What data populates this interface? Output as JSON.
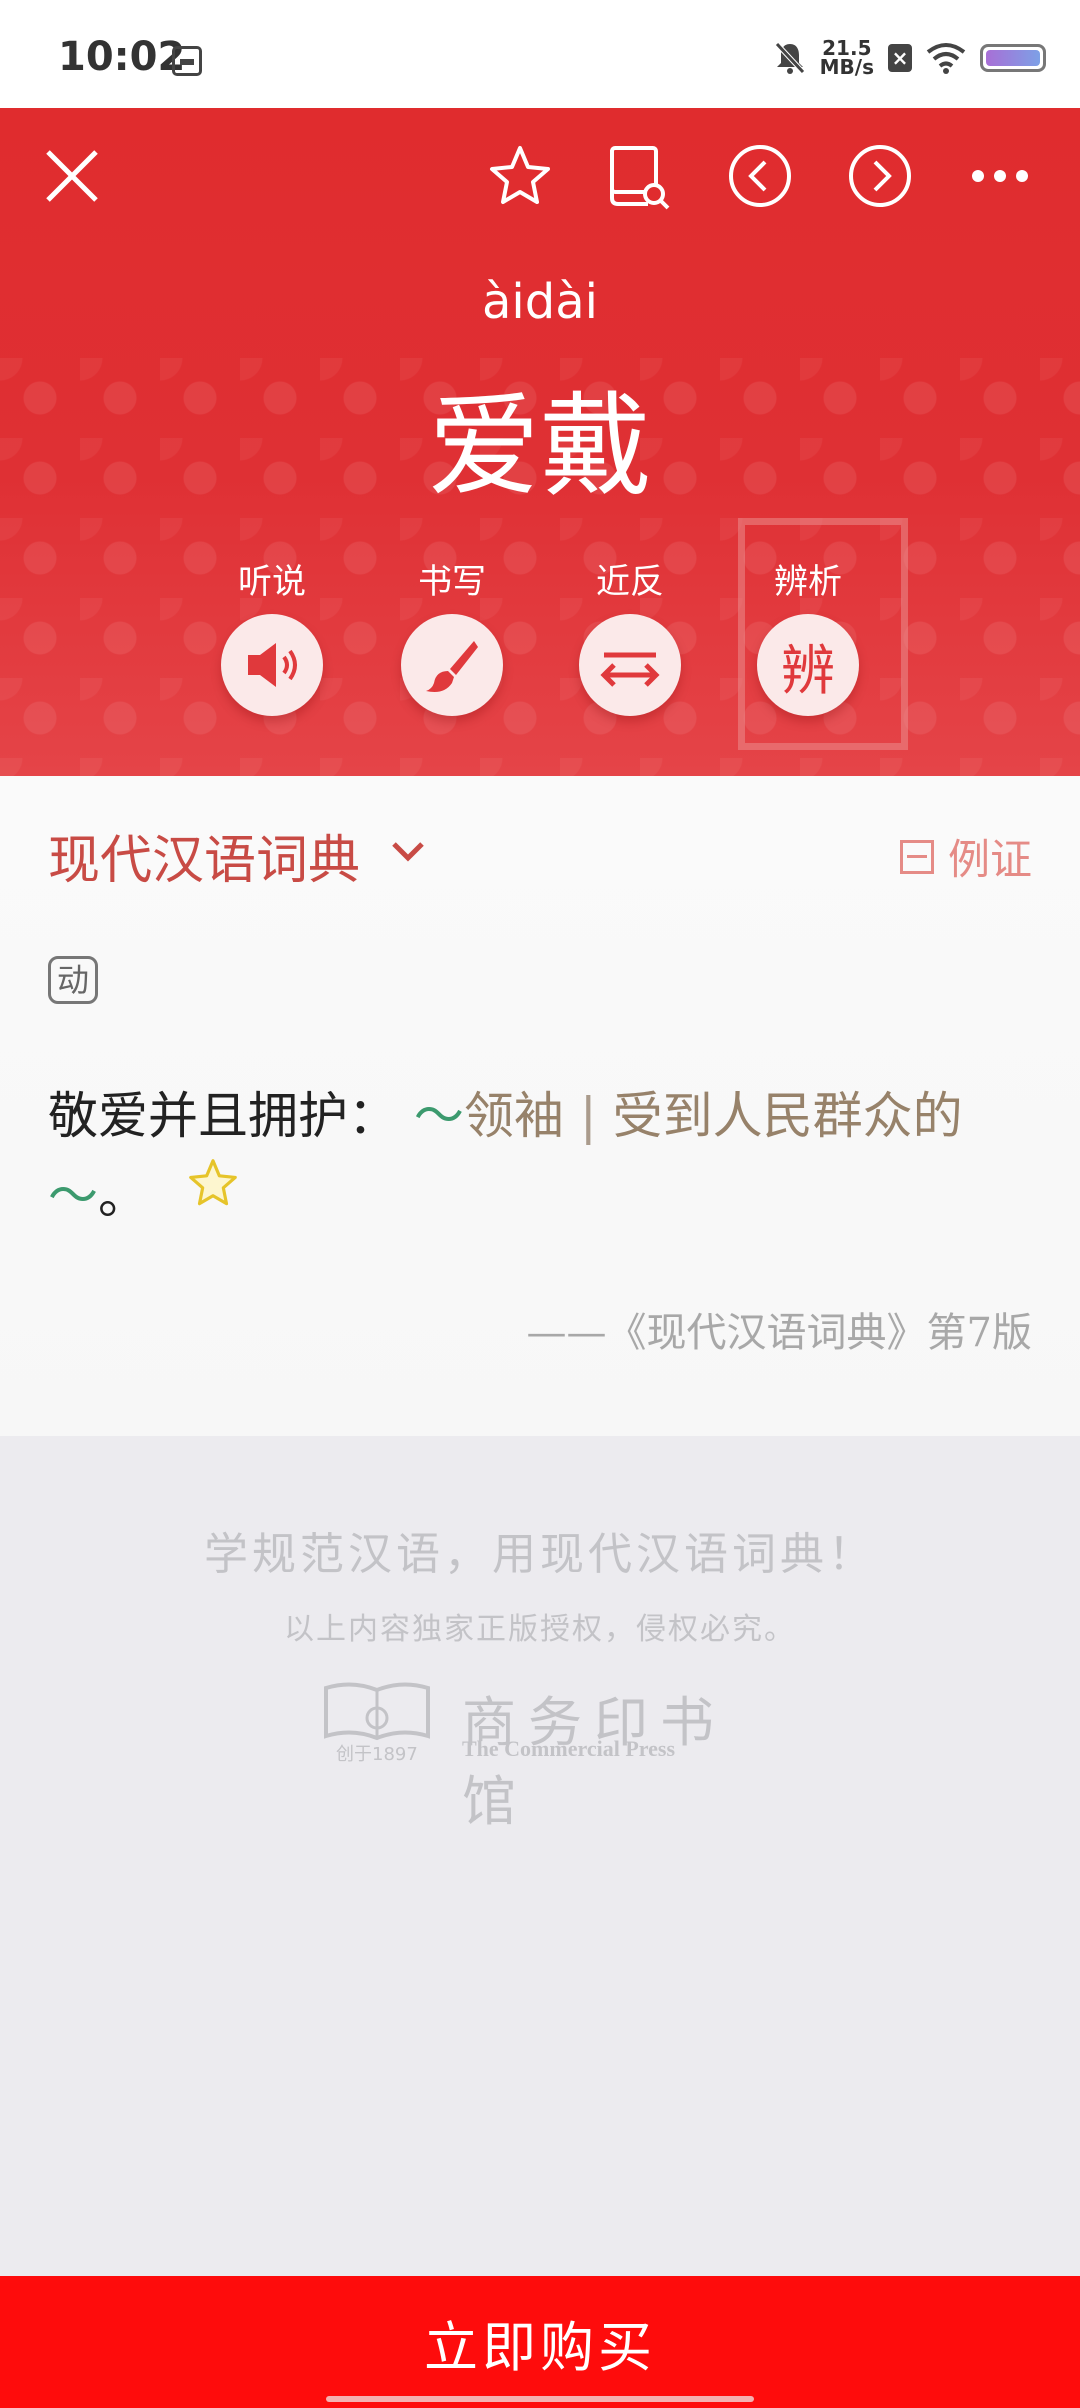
{
  "status_bar": {
    "time": "10:02",
    "net_speed_value": "21.5",
    "net_speed_unit": "MB/s"
  },
  "header": {
    "pinyin": "àidài",
    "headword": "爱戴",
    "functions": [
      {
        "label": "听说",
        "icon": "speaker-icon"
      },
      {
        "label": "书写",
        "icon": "brush-icon"
      },
      {
        "label": "近反",
        "icon": "swap-arrows-icon"
      },
      {
        "label": "辨析",
        "glyph": "辨"
      }
    ]
  },
  "entry": {
    "dictionary": "现代汉语词典",
    "examples_toggle": "例证",
    "part_of_speech": "动",
    "definition": "敬爱并且拥护：",
    "tilde": "～",
    "example_1": "领袖",
    "separator": "|",
    "example_2": "受到人民群众的",
    "end_period": "。",
    "source": "——《现代汉语词典》第7版"
  },
  "footer": {
    "slogan": "学规范汉语，用现代汉语词典！",
    "copyright": "以上内容独家正版授权，侵权必究。",
    "publisher_cn": "商务印书馆",
    "publisher_en": "The Commercial Press",
    "founded": "创于1897"
  },
  "buy_button": "立即购买",
  "colors": {
    "header_red": "#e02c2e",
    "buy_red": "#fe0c0c",
    "dict_title": "#c84b45",
    "tilde_green": "#3c9a6e",
    "example_brown": "#97826a"
  }
}
